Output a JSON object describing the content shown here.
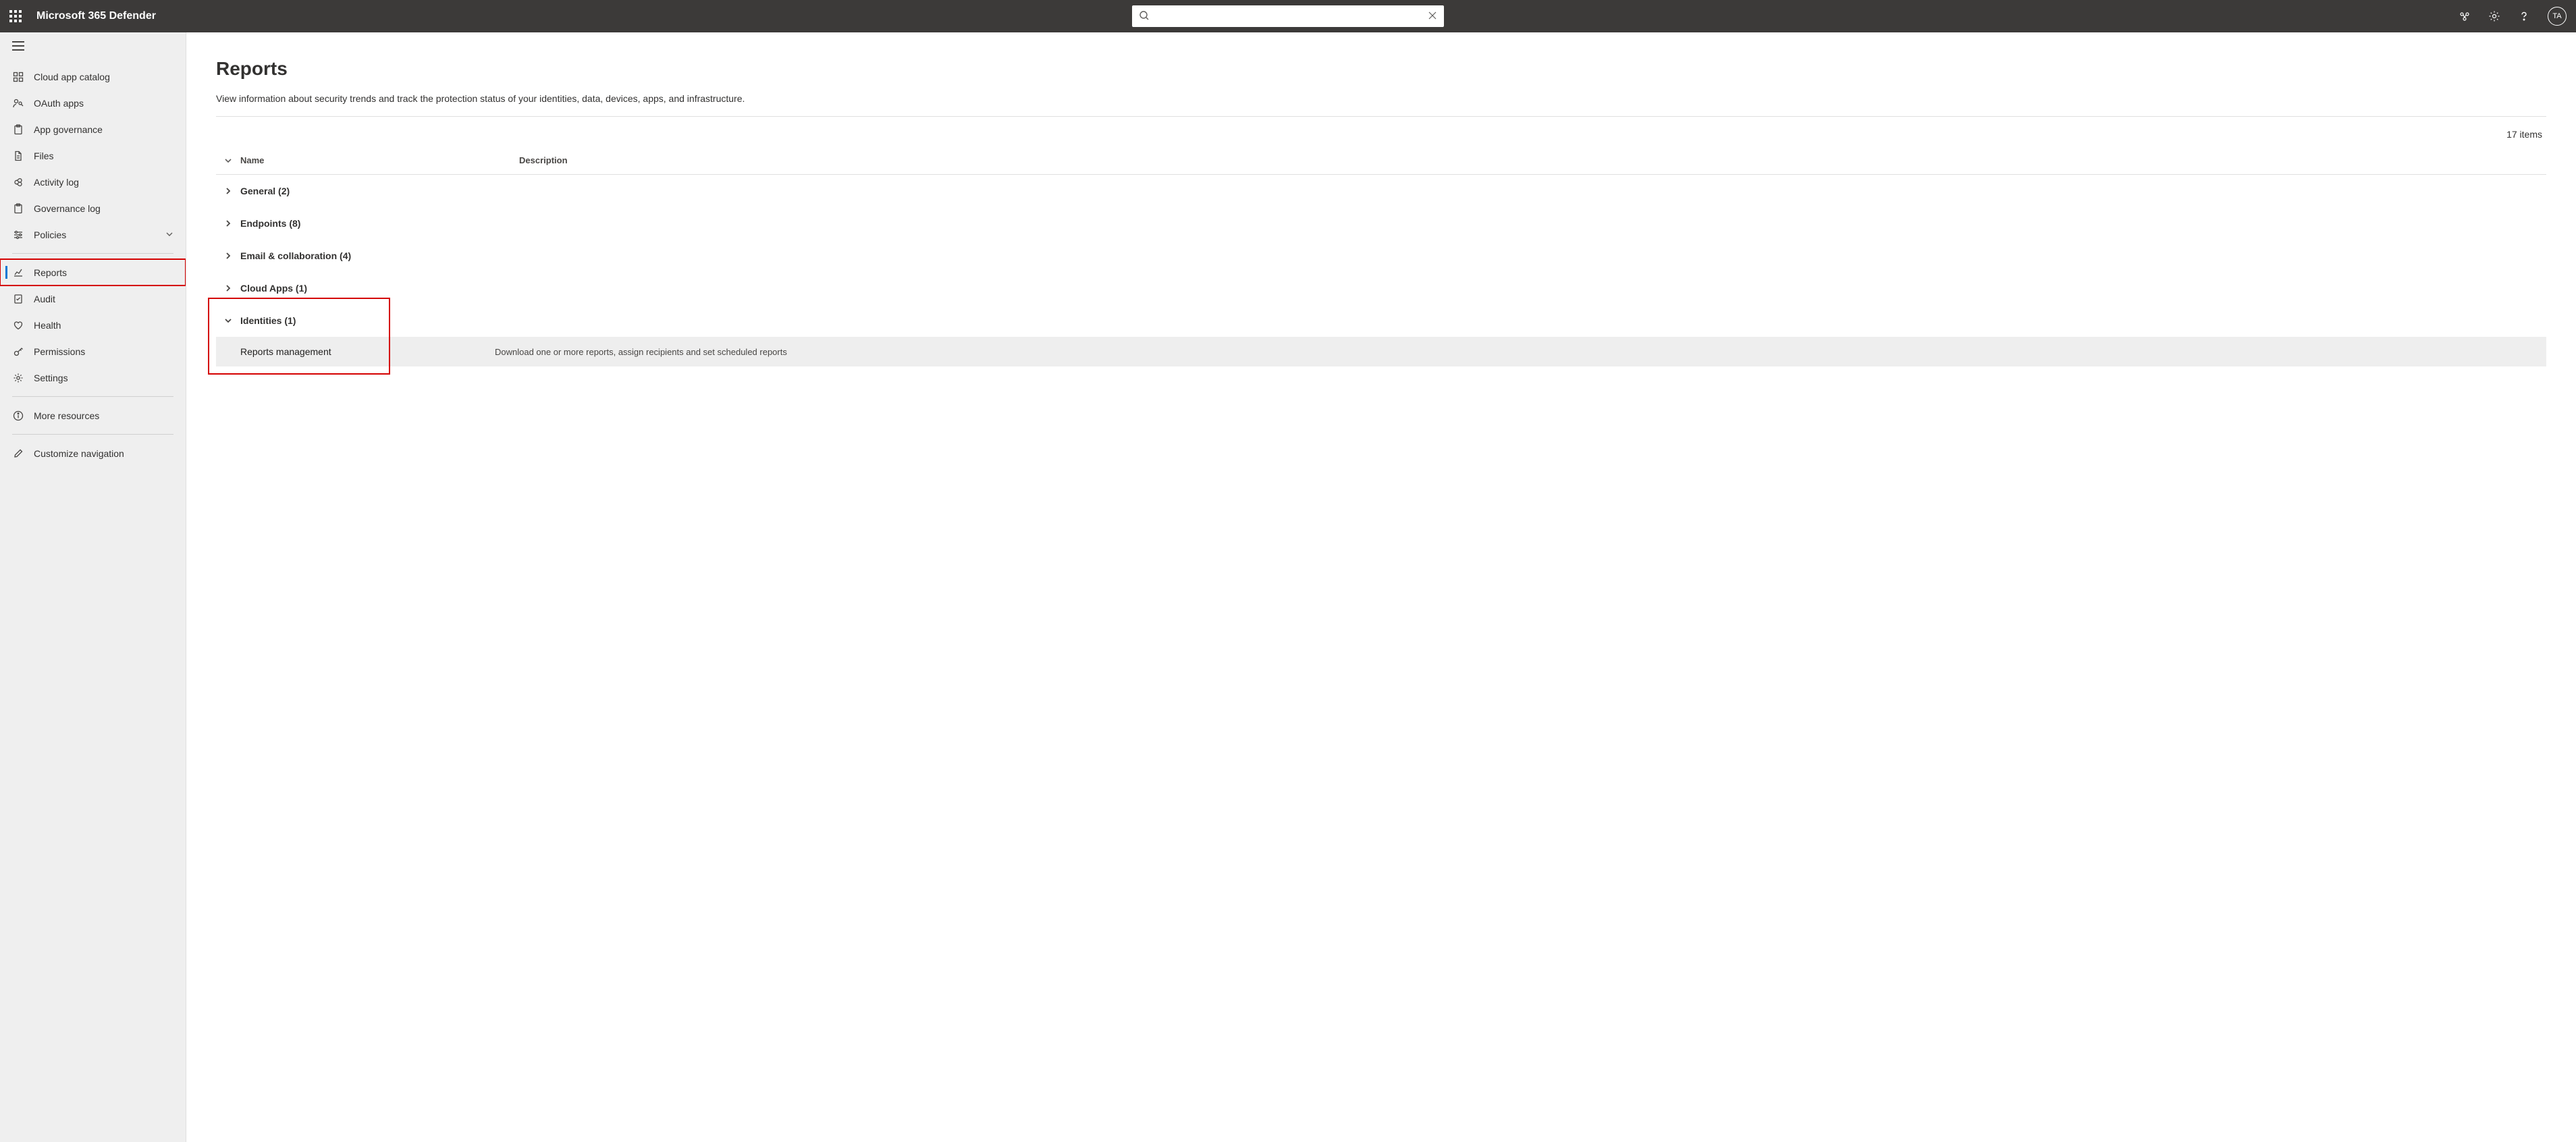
{
  "header": {
    "product": "Microsoft 365 Defender",
    "search_placeholder": "",
    "avatar_initials": "TA"
  },
  "sidebar": {
    "items": [
      {
        "id": "cloud-app-catalog",
        "label": "Cloud app catalog",
        "icon": "grid-icon"
      },
      {
        "id": "oauth-apps",
        "label": "OAuth apps",
        "icon": "person-key-icon"
      },
      {
        "id": "app-governance",
        "label": "App governance",
        "icon": "clipboard-icon"
      },
      {
        "id": "files",
        "label": "Files",
        "icon": "file-icon"
      },
      {
        "id": "activity-log",
        "label": "Activity log",
        "icon": "infinity-icon"
      },
      {
        "id": "governance-log",
        "label": "Governance log",
        "icon": "clipboard-icon"
      },
      {
        "id": "policies",
        "label": "Policies",
        "icon": "sliders-icon",
        "chevron": true
      }
    ],
    "items2": [
      {
        "id": "reports",
        "label": "Reports",
        "icon": "chart-icon",
        "active": true,
        "highlight": true
      },
      {
        "id": "audit",
        "label": "Audit",
        "icon": "page-check-icon"
      },
      {
        "id": "health",
        "label": "Health",
        "icon": "heart-icon"
      },
      {
        "id": "permissions",
        "label": "Permissions",
        "icon": "key-icon"
      },
      {
        "id": "settings",
        "label": "Settings",
        "icon": "gear-icon"
      }
    ],
    "footer": [
      {
        "id": "more-resources",
        "label": "More resources",
        "icon": "info-icon"
      },
      {
        "id": "customize-nav",
        "label": "Customize navigation",
        "icon": "pencil-icon"
      }
    ]
  },
  "main": {
    "title": "Reports",
    "description": "View information about security trends and track the protection status of your identities, data, devices, apps, and infrastructure.",
    "items_count_label": "17 items",
    "columns": {
      "name": "Name",
      "description": "Description"
    },
    "groups": [
      {
        "label": "General (2)",
        "expanded": false
      },
      {
        "label": "Endpoints (8)",
        "expanded": false
      },
      {
        "label": "Email & collaboration (4)",
        "expanded": false
      },
      {
        "label": "Cloud Apps (1)",
        "expanded": false
      },
      {
        "label": "Identities (1)",
        "expanded": true,
        "highlight": true,
        "children": [
          {
            "name": "Reports management",
            "description": "Download one or more reports, assign recipients and set scheduled reports"
          }
        ]
      }
    ]
  }
}
